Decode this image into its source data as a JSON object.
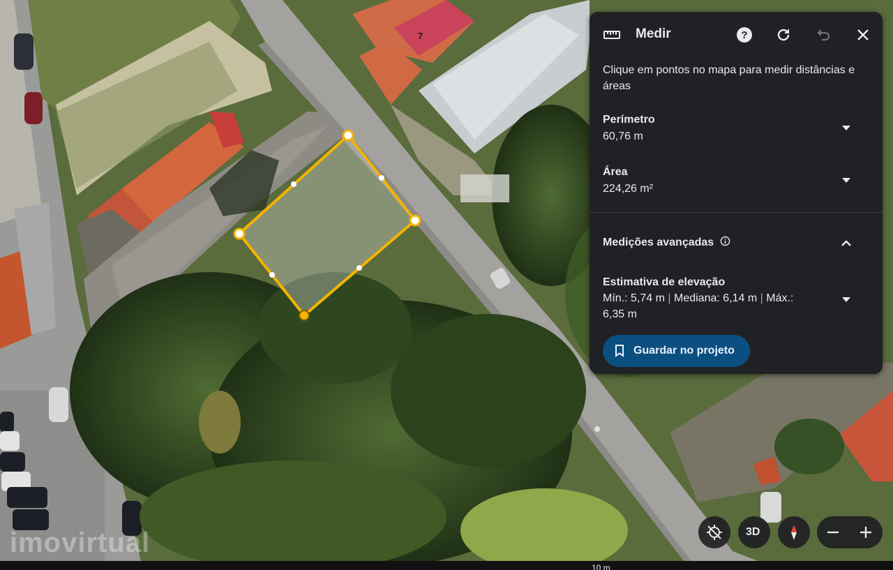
{
  "panel": {
    "title": "Medir",
    "description": "Clique em pontos no mapa para medir distâncias e áreas",
    "perimeter": {
      "label": "Perímetro",
      "value": "60,76 m"
    },
    "area": {
      "label": "Área",
      "value": "224,26 m²"
    },
    "advanced": {
      "label": "Medições avançadas"
    },
    "elevation": {
      "label": "Estimativa de elevação",
      "min": "Mín.: 5,74 m",
      "median": "Mediana: 6,14 m",
      "max": "Máx.: 6,35 m"
    },
    "save_label": "Guardar no projeto",
    "icons": [
      "ruler-icon",
      "help-icon",
      "refresh-icon",
      "undo-icon",
      "close-icon",
      "info-icon",
      "bookmark-icon"
    ]
  },
  "map": {
    "house_number": "7",
    "watermark": "imovirtual",
    "scale_text": "10 m"
  },
  "controls": {
    "btn_3d": "3D",
    "icons": [
      "location-off-icon",
      "compass-icon",
      "zoom-out-icon",
      "zoom-in-icon"
    ]
  },
  "colors": {
    "panel_bg": "#202124",
    "accent_button": "#0a4f80",
    "measure_line": "#f4b400",
    "compass_red": "#ea4335"
  }
}
